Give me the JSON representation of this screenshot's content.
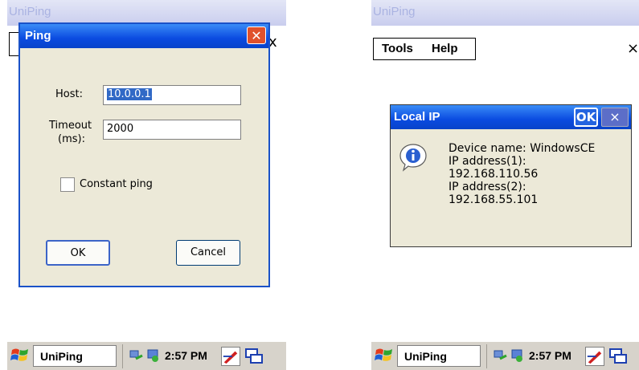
{
  "left_screen": {
    "window_title": "UniPing",
    "dialog": {
      "title": "Ping",
      "close_glyph": "✕",
      "host_label": "Host:",
      "host_value": "10.0.0.1",
      "timeout_label_1": "Timeout",
      "timeout_label_2": "(ms):",
      "timeout_value": "2000",
      "constant_ping_label": "Constant ping",
      "constant_ping_checked": false,
      "ok_label": "OK",
      "cancel_label": "Cancel"
    },
    "taskbar": {
      "app_label": "UniPing",
      "clock": "2:57 PM"
    }
  },
  "right_screen": {
    "window_title": "UniPing",
    "menu": {
      "tools": "Tools",
      "help": "Help"
    },
    "close_glyph": "×",
    "dialog": {
      "title": "Local IP",
      "ok_label": "OK",
      "close_glyph": "×",
      "lines": [
        "Device name: WindowsCE",
        "IP address(1):",
        "192.168.110.56",
        "IP address(2):",
        "192.168.55.101"
      ]
    },
    "taskbar": {
      "app_label": "UniPing",
      "clock": "2:57 PM"
    }
  },
  "icons": {
    "start": "windows-flag-icon",
    "tray_network": "network-icon",
    "tray_sync": "sync-icon",
    "tray_input": "pen-input-icon",
    "tray_desktop": "desktop-switch-icon",
    "dialog_info": "info-icon"
  },
  "colors": {
    "titlebar_blue": "#0a4be0",
    "close_red": "#e0512c",
    "dialog_bg": "#ece9d8",
    "selection": "#3169c6"
  }
}
